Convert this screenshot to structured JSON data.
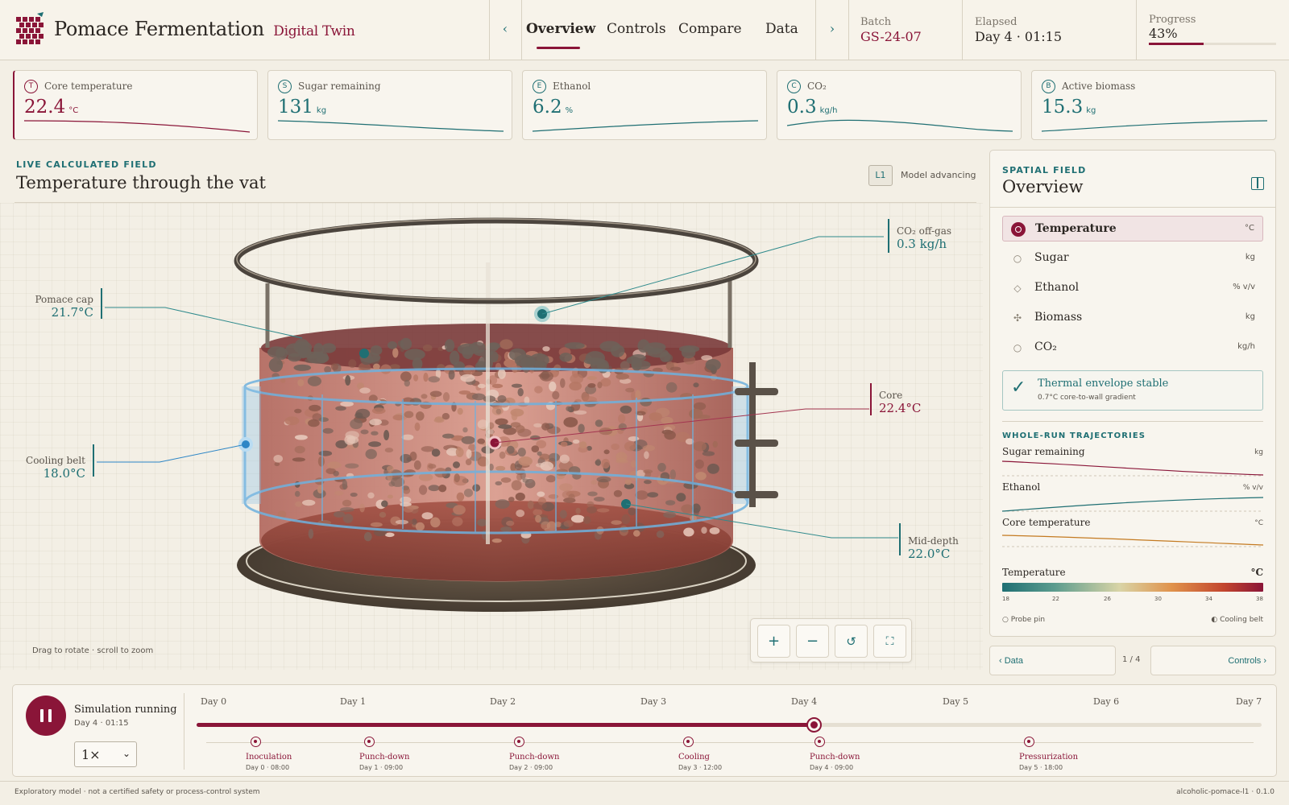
{
  "app": {
    "title": "Pomace Fermentation",
    "subtitle": "Digital Twin",
    "logo_icon": "wine-grape-logo"
  },
  "nav": {
    "tabs": [
      {
        "label": "Overview",
        "active": true
      },
      {
        "label": "Controls",
        "active": false
      },
      {
        "label": "Compare",
        "active": false
      },
      {
        "label": "Data",
        "active": false
      }
    ],
    "prev_icon": "chevron-left-icon",
    "next_icon": "chevron-right-icon"
  },
  "header_stats": {
    "batch": {
      "label": "Batch",
      "value": "GS-24-07"
    },
    "elapsed": {
      "label": "Elapsed",
      "value": "Day 4 · 01:15"
    },
    "progress": {
      "label": "Progress",
      "value": "43%",
      "fraction": 0.43
    }
  },
  "metrics": [
    {
      "badge": "T",
      "label": "Core temperature",
      "value": "22.4",
      "unit": "°C"
    },
    {
      "badge": "S",
      "label": "Sugar remaining",
      "value": "131",
      "unit": "kg"
    },
    {
      "badge": "E",
      "label": "Ethanol",
      "value": "6.2",
      "unit": "%"
    },
    {
      "badge": "C",
      "label": "CO₂",
      "value": "0.3",
      "unit": "kg/h"
    },
    {
      "badge": "B",
      "label": "Active biomass",
      "value": "15.3",
      "unit": "kg"
    }
  ],
  "main": {
    "eyebrow": "LIVE CALCULATED FIELD",
    "title": "Temperature through the vat",
    "model_badge": "L1",
    "model_status": "Model advancing",
    "drag_hint": "Drag to rotate · scroll to zoom"
  },
  "callouts": {
    "pomace_cap": {
      "label": "Pomace cap",
      "value": "21.7°C"
    },
    "co2": {
      "label": "CO₂ off-gas",
      "value": "0.3 kg/h"
    },
    "core": {
      "label": "Core",
      "value": "22.4°C"
    },
    "cooling_belt": {
      "label": "Cooling belt",
      "value": "18.0°C"
    },
    "mid_depth": {
      "label": "Mid-depth",
      "value": "22.0°C"
    }
  },
  "zoom_controls": {
    "zoom_in": "+",
    "zoom_out": "−",
    "reset": "↺",
    "fullscreen": "⛶"
  },
  "right_panel": {
    "eyebrow": "SPATIAL FIELD",
    "title": "Overview",
    "layers": [
      {
        "label": "Temperature",
        "unit": "°C",
        "icon": "○",
        "active": true
      },
      {
        "label": "Sugar",
        "unit": "kg",
        "icon": "○",
        "active": false
      },
      {
        "label": "Ethanol",
        "unit": "% v/v",
        "icon": "◇",
        "active": false
      },
      {
        "label": "Biomass",
        "unit": "kg",
        "icon": "✣",
        "active": false
      },
      {
        "label": "CO₂",
        "unit": "kg/h",
        "icon": "○",
        "active": false
      }
    ],
    "status": {
      "check": "✓",
      "title": "Thermal envelope stable",
      "detail": "0.7°C core-to-wall gradient"
    },
    "trajectories_eyebrow": "WHOLE-RUN TRAJECTORIES",
    "trajectories": [
      {
        "label": "Sugar remaining",
        "unit": "kg",
        "color": "#8a1538"
      },
      {
        "label": "Ethanol",
        "unit": "% v/v",
        "color": "#1f6f73"
      },
      {
        "label": "Core temperature",
        "unit": "°C",
        "color": "#c47a20"
      }
    ],
    "legend": {
      "title": "Temperature",
      "unit": "°C",
      "ticks": [
        "18",
        "22",
        "26",
        "30",
        "34",
        "38"
      ],
      "probe_label": "○ Probe pin",
      "belt_label": "◐ Cooling belt"
    }
  },
  "pager": {
    "prev": "‹ Data",
    "count": "1 / 4",
    "next": "Controls ›"
  },
  "timeline": {
    "status": "Simulation running",
    "time": "Day 4 · 01:15",
    "speed": "1×",
    "days": [
      "Day 0",
      "Day 1",
      "Day 2",
      "Day 3",
      "Day 4",
      "Day 5",
      "Day 6",
      "Day 7"
    ],
    "progress_fraction": 0.58,
    "events": [
      {
        "name": "Inoculation",
        "time": "Day 0 · 08:00"
      },
      {
        "name": "Punch-down",
        "time": "Day 1 · 09:00"
      },
      {
        "name": "Punch-down",
        "time": "Day 2 · 09:00"
      },
      {
        "name": "Cooling",
        "time": "Day 3 · 12:00"
      },
      {
        "name": "Punch-down",
        "time": "Day 4 · 09:00"
      },
      {
        "name": "Pressurization",
        "time": "Day 5 · 18:00"
      }
    ]
  },
  "footer": {
    "disclaimer": "Exploratory model · not a certified safety or process-control system",
    "version": "alcoholic-pomace-l1 · 0.1.0"
  },
  "colors": {
    "wine": "#8a1538",
    "teal": "#1f6f73",
    "amber": "#c47a20",
    "bg": "#f3efe5"
  }
}
